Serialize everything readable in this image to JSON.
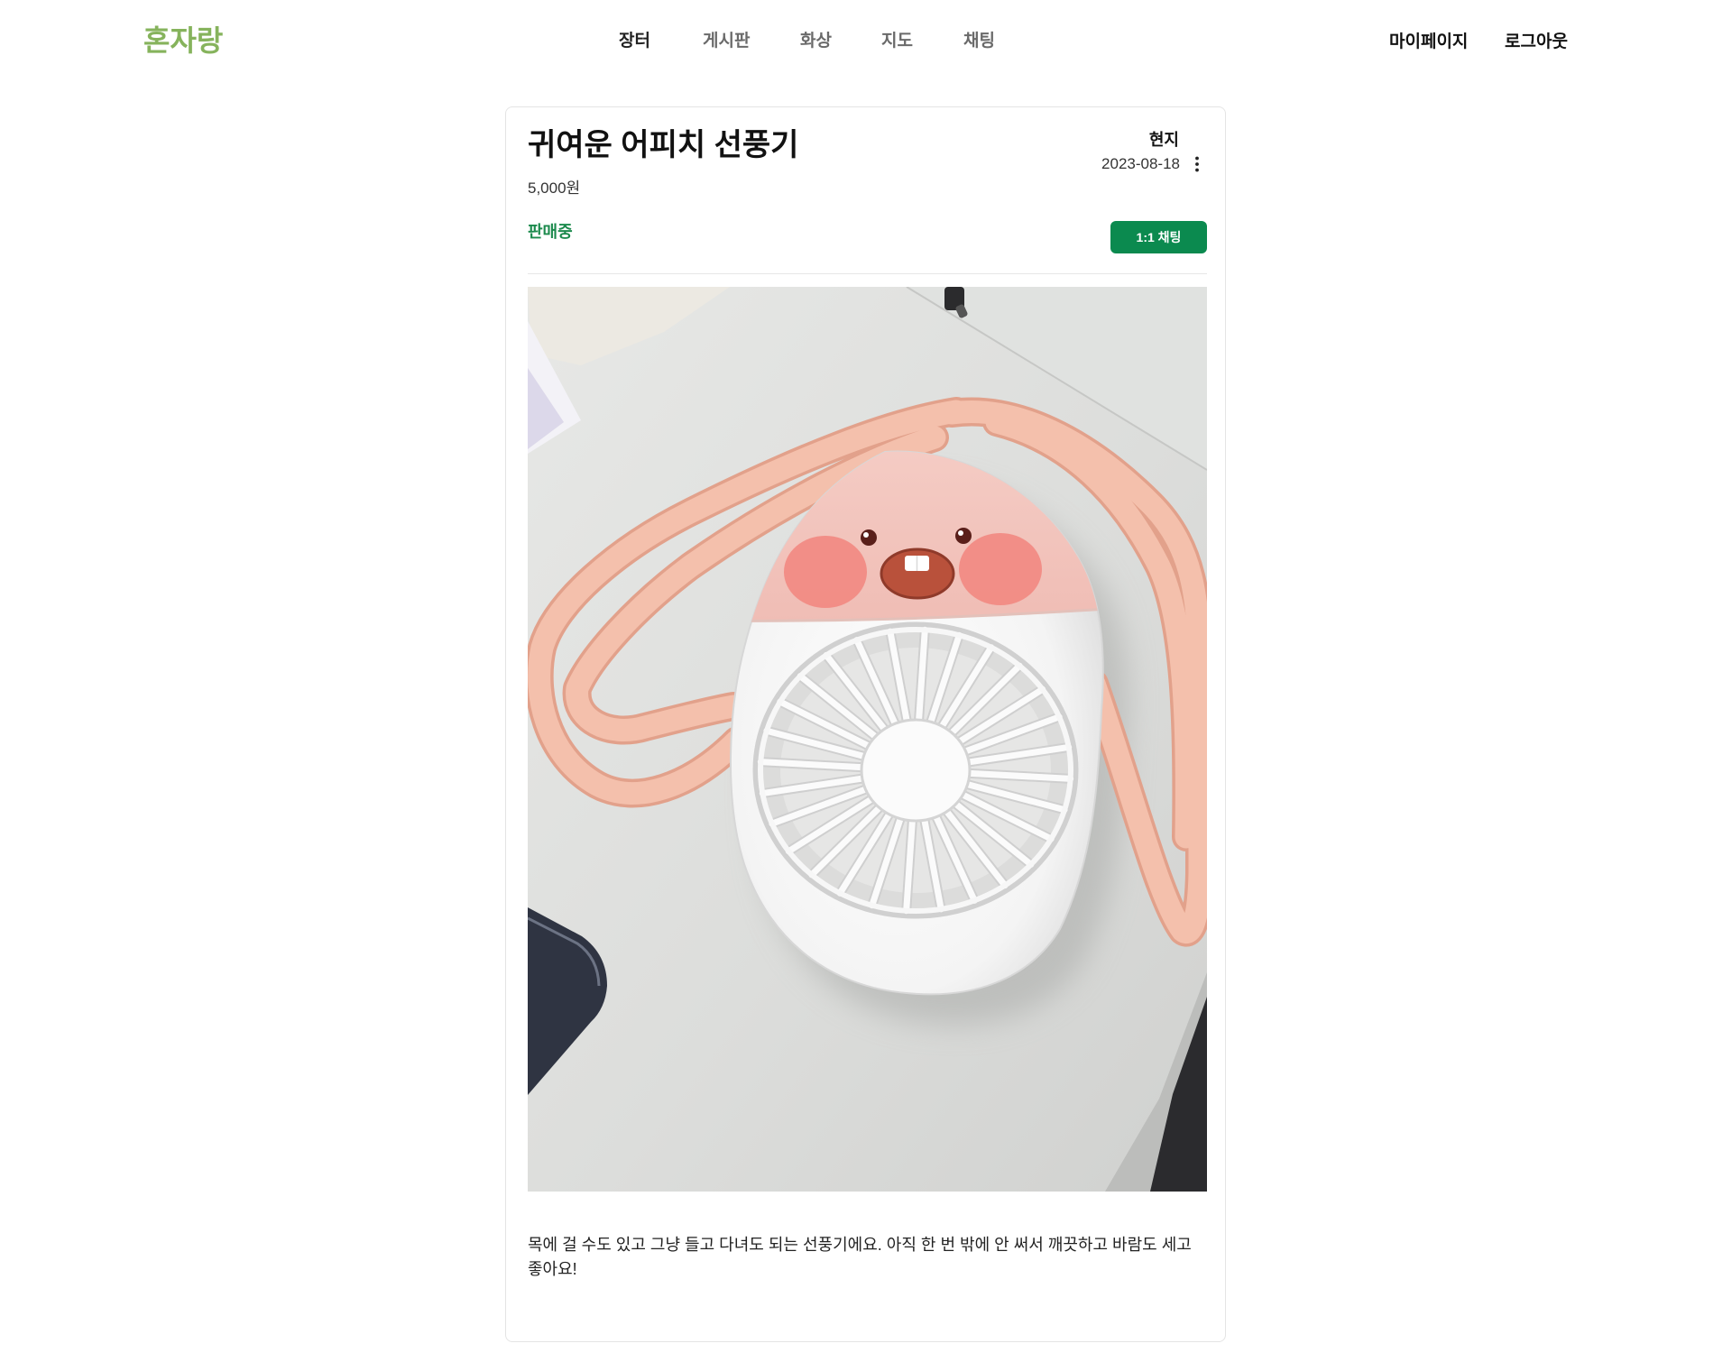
{
  "header": {
    "logo": "혼자랑",
    "nav": [
      {
        "label": "장터",
        "active": true
      },
      {
        "label": "게시판",
        "active": false
      },
      {
        "label": "화상",
        "active": false
      },
      {
        "label": "지도",
        "active": false
      },
      {
        "label": "채팅",
        "active": false
      }
    ],
    "user_menu": {
      "mypage": "마이페이지",
      "logout": "로그아웃"
    }
  },
  "post": {
    "title": "귀여운 어피치 선풍기",
    "price": "5,000원",
    "seller": "현지",
    "date": "2023-08-18",
    "more_icon": "more-vertical-icon",
    "status": "판매중",
    "chat_button": "1:1 채팅",
    "description": "목에 걸 수도 있고 그냥 들고 다녀도 되는 선풍기에요. 아직 한 번 밖에 안 써서 깨끗하고 바람도 세고 좋아요!"
  },
  "colors": {
    "brand": "#86b35c",
    "status": "#1c8a4d",
    "button_bg": "#0b8a4f"
  }
}
